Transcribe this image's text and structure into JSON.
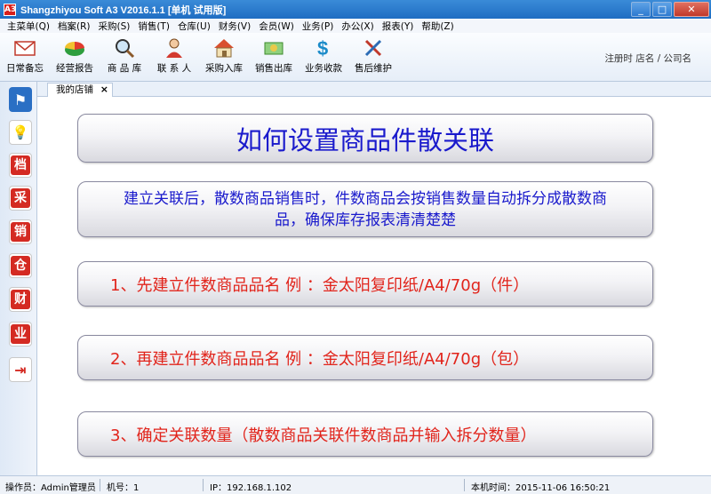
{
  "window": {
    "title": "Shangzhiyou Soft A3 V2016.1.1 [单机 试用版]",
    "app_icon_glyph": "A3"
  },
  "menu": [
    "主菜单(Q)",
    "档案(R)",
    "采购(S)",
    "销售(T)",
    "仓库(U)",
    "财务(V)",
    "会员(W)",
    "业务(P)",
    "办公(X)",
    "报表(Y)",
    "帮助(Z)"
  ],
  "toolbar": {
    "items": [
      {
        "label": "日常备忘",
        "icon": "mail-icon"
      },
      {
        "label": "经营报告",
        "icon": "pie-chart-icon"
      },
      {
        "label": "商 品 库",
        "icon": "magnifier-icon"
      },
      {
        "label": "联 系 人",
        "icon": "person-icon"
      },
      {
        "label": "采购入库",
        "icon": "house-icon"
      },
      {
        "label": "销售出库",
        "icon": "money-icon"
      },
      {
        "label": "业务收款",
        "icon": "dollar-icon"
      },
      {
        "label": "售后维护",
        "icon": "tools-icon"
      }
    ],
    "registration": "注册时 店名 / 公司名"
  },
  "sidebar": [
    {
      "name": "flag",
      "glyph": "⚑"
    },
    {
      "name": "idea",
      "glyph": "💡"
    },
    {
      "name": "archive",
      "glyph": "档"
    },
    {
      "name": "purchase",
      "glyph": "采"
    },
    {
      "name": "sales",
      "glyph": "销"
    },
    {
      "name": "warehouse",
      "glyph": "仓"
    },
    {
      "name": "finance",
      "glyph": "财"
    },
    {
      "name": "business",
      "glyph": "业"
    },
    {
      "name": "exit",
      "glyph": "⇥"
    }
  ],
  "tab": {
    "label": "我的店铺",
    "close": "×"
  },
  "content": {
    "title": "如何设置商品件散关联",
    "description": "建立关联后，散数商品销售时，件数商品会按销售数量自动拆分成散数商品，确保库存报表清清楚楚",
    "steps": [
      "1、先建立件数商品品名  例 ：金太阳复印纸/A4/70g（件）",
      "2、再建立件数商品品名  例 ：金太阳复印纸/A4/70g（包）",
      "3、确定关联数量（散数商品关联件数商品并输入拆分数量）"
    ]
  },
  "status": {
    "operator": "操作员：Admin管理员",
    "machine": "机号：1",
    "ip": "IP：192.168.1.102",
    "time": "本机时间：2015-11-06 16:50:21"
  },
  "colors": {
    "title_blue": "#1a1acc",
    "step_red": "#e1241b",
    "titlebar": "#2d7ad0"
  }
}
